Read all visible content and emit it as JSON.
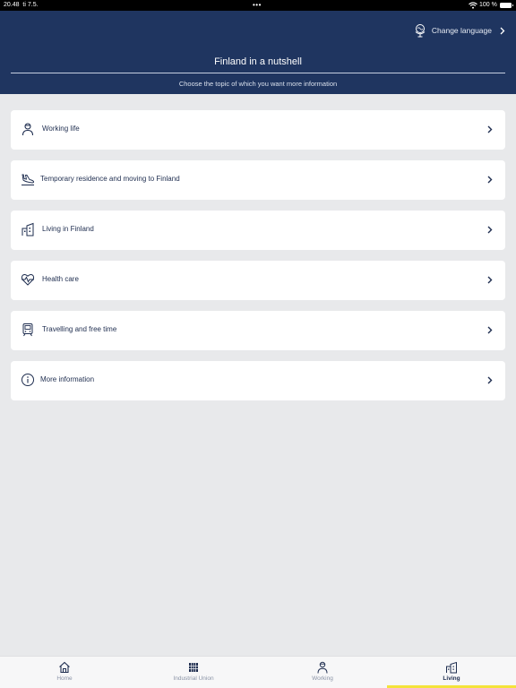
{
  "status_bar": {
    "time": "20.48",
    "date": "ti 7.5.",
    "dots": "•••",
    "battery": "100 %"
  },
  "header": {
    "change_language": "Change language",
    "title": "Finland in a nutshell",
    "subtitle": "Choose the topic of which you want more information"
  },
  "topics": [
    {
      "label": "Working life",
      "icon": "person-icon"
    },
    {
      "label": "Temporary residence and moving to Finland",
      "icon": "plane-landing-icon"
    },
    {
      "label": "Living in Finland",
      "icon": "building-icon"
    },
    {
      "label": "Health care",
      "icon": "heart-pulse-icon"
    },
    {
      "label": "Travelling and free time",
      "icon": "train-icon"
    },
    {
      "label": "More information",
      "icon": "info-icon"
    }
  ],
  "tabs": [
    {
      "label": "Home",
      "icon": "home-icon",
      "active": false
    },
    {
      "label": "Industrial Union",
      "icon": "union-logo-icon",
      "active": false
    },
    {
      "label": "Working",
      "icon": "person-icon",
      "active": false
    },
    {
      "label": "Living",
      "icon": "building-icon",
      "active": true
    }
  ],
  "colors": {
    "header_bg": "#1f3560",
    "page_bg": "#e8e9eb",
    "text_dark": "#1e2d4f",
    "active_indicator": "#f4e33a"
  }
}
